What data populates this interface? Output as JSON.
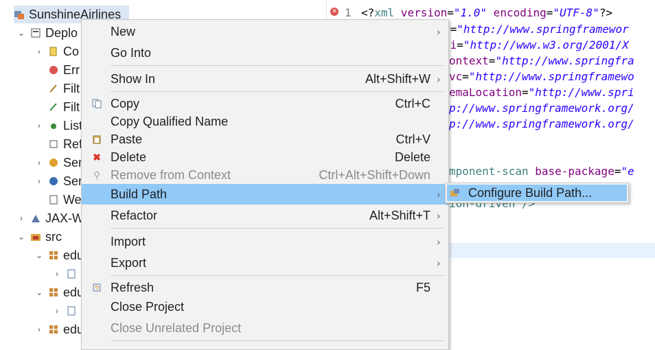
{
  "tree": {
    "project": "SunshineAirlines",
    "deployed": "Deplo",
    "items": [
      "Co",
      "Err",
      "Filt",
      "Filt",
      "List",
      "Ref",
      "Ser",
      "Ser",
      "We"
    ],
    "jax": "JAX-W",
    "src": "src",
    "edu_items": [
      "edu",
      "edu",
      "edu"
    ]
  },
  "editor": {
    "line1_no": "1",
    "line1": {
      "open": "<?",
      "tag": "xml",
      "attr1": " version",
      "eq1": "=",
      "val1": "\"1.0\"",
      "attr2": " encoding",
      "eq2": "=",
      "val2": "\"UTF-8\"",
      "close": "?>"
    },
    "fragments": [
      {
        "attr": "s",
        "val": "\"http://www.springframewor"
      },
      {
        "attr": "si",
        "val": "\"http://www.w3.org/2001/X"
      },
      {
        "attr": "ontext",
        "val": "\"http://www.springfra"
      },
      {
        "attr": "vc",
        "val": "\"http://www.springframewo"
      },
      {
        "attr": "emaLocation",
        "val": "\"http://www.spri"
      },
      {
        "attr": "",
        "val": "p://www.springframework.org/"
      },
      {
        "attr": "",
        "val": "p://www.springframework.org/"
      }
    ],
    "component_scan": "mponent-scan",
    "base_package_attr": " base-package",
    "base_package_val": "\"e",
    "annotation_frag": "ion-driven />"
  },
  "menu": {
    "items": [
      {
        "label": "New",
        "shortcut": "",
        "submenu": true
      },
      {
        "label": "Go Into",
        "shortcut": "",
        "submenu": false
      },
      {
        "label": "Show In",
        "shortcut": "Alt+Shift+W",
        "submenu": true
      },
      {
        "label": "Copy",
        "shortcut": "Ctrl+C",
        "submenu": false
      },
      {
        "label": "Copy Qualified Name",
        "shortcut": "",
        "submenu": false
      },
      {
        "label": "Paste",
        "shortcut": "Ctrl+V",
        "submenu": false
      },
      {
        "label": "Delete",
        "shortcut": "Delete",
        "submenu": false
      },
      {
        "label": "Remove from Context",
        "shortcut": "Ctrl+Alt+Shift+Down",
        "submenu": false
      },
      {
        "label": "Build Path",
        "shortcut": "",
        "submenu": true
      },
      {
        "label": "Refactor",
        "shortcut": "Alt+Shift+T",
        "submenu": true
      },
      {
        "label": "Import",
        "shortcut": "",
        "submenu": true
      },
      {
        "label": "Export",
        "shortcut": "",
        "submenu": true
      },
      {
        "label": "Refresh",
        "shortcut": "F5",
        "submenu": false
      },
      {
        "label": "Close Project",
        "shortcut": "",
        "submenu": false
      },
      {
        "label": "Close Unrelated Project",
        "shortcut": "",
        "submenu": false
      }
    ],
    "arrow": "›"
  },
  "submenu": {
    "label": "Configure Build Path..."
  },
  "colors": {
    "highlight": "#91c9f7",
    "menu_bg": "#f2f2f2",
    "disabled_text": "#8a8a8a",
    "delete_icon": "#d9342b"
  }
}
